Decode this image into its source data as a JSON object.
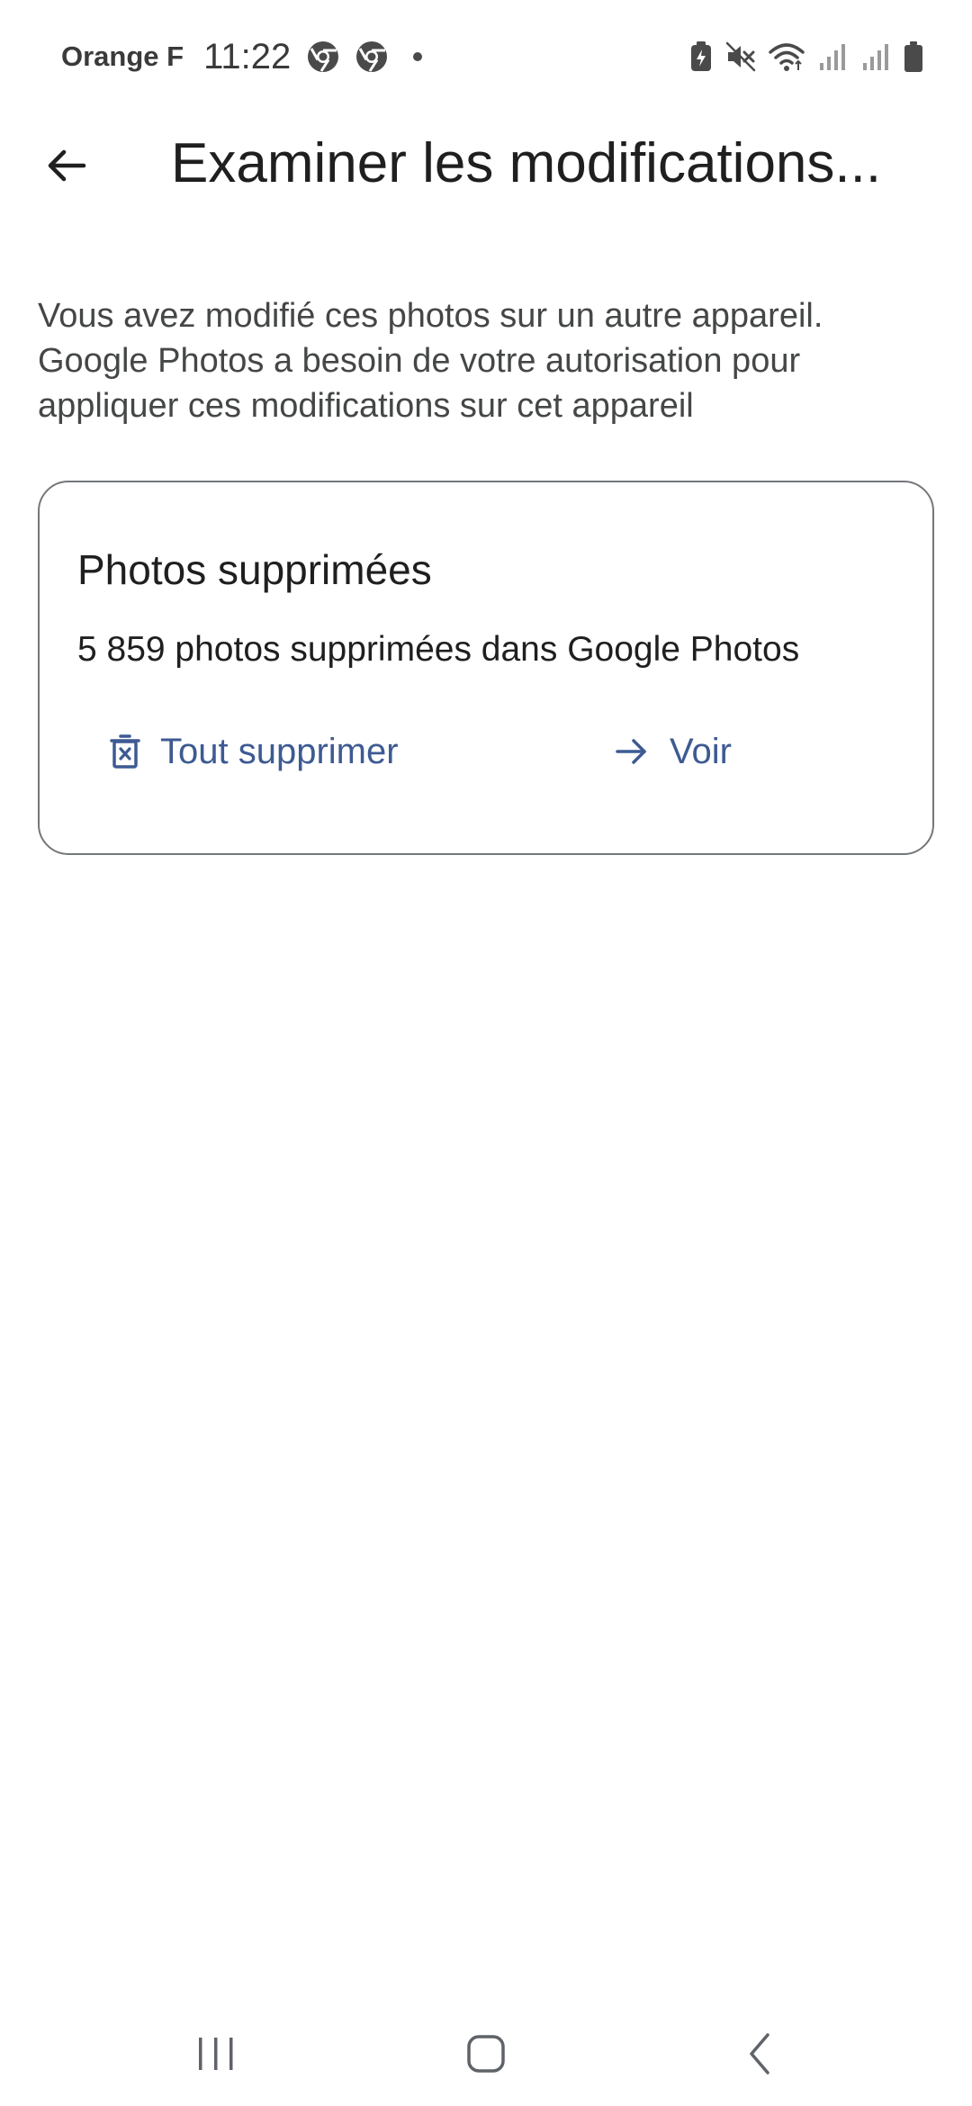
{
  "status_bar": {
    "carrier": "Orange F",
    "time": "11:22",
    "notification_icons": [
      "chrome-icon",
      "chrome-icon",
      "dot"
    ],
    "system_icons": [
      "battery-saver-icon",
      "mute-icon",
      "wifi-icon",
      "signal-icon",
      "signal-icon",
      "battery-icon"
    ]
  },
  "app_bar": {
    "title": "Examiner les modifications..."
  },
  "description": "Vous avez modifié ces photos sur un autre appareil. Google Photos a besoin de votre autorisation pour appliquer ces modifications sur cet appareil",
  "card": {
    "title": "Photos supprimées",
    "subtitle": "5 859 photos supprimées dans Google Photos",
    "actions": {
      "delete_all": "Tout supprimer",
      "view": "Voir"
    }
  },
  "colors": {
    "accent": "#3d5a92",
    "text_primary": "#1f1f1f",
    "text_secondary": "#444746",
    "card_border": "#74777a",
    "background": "#ffffff"
  }
}
